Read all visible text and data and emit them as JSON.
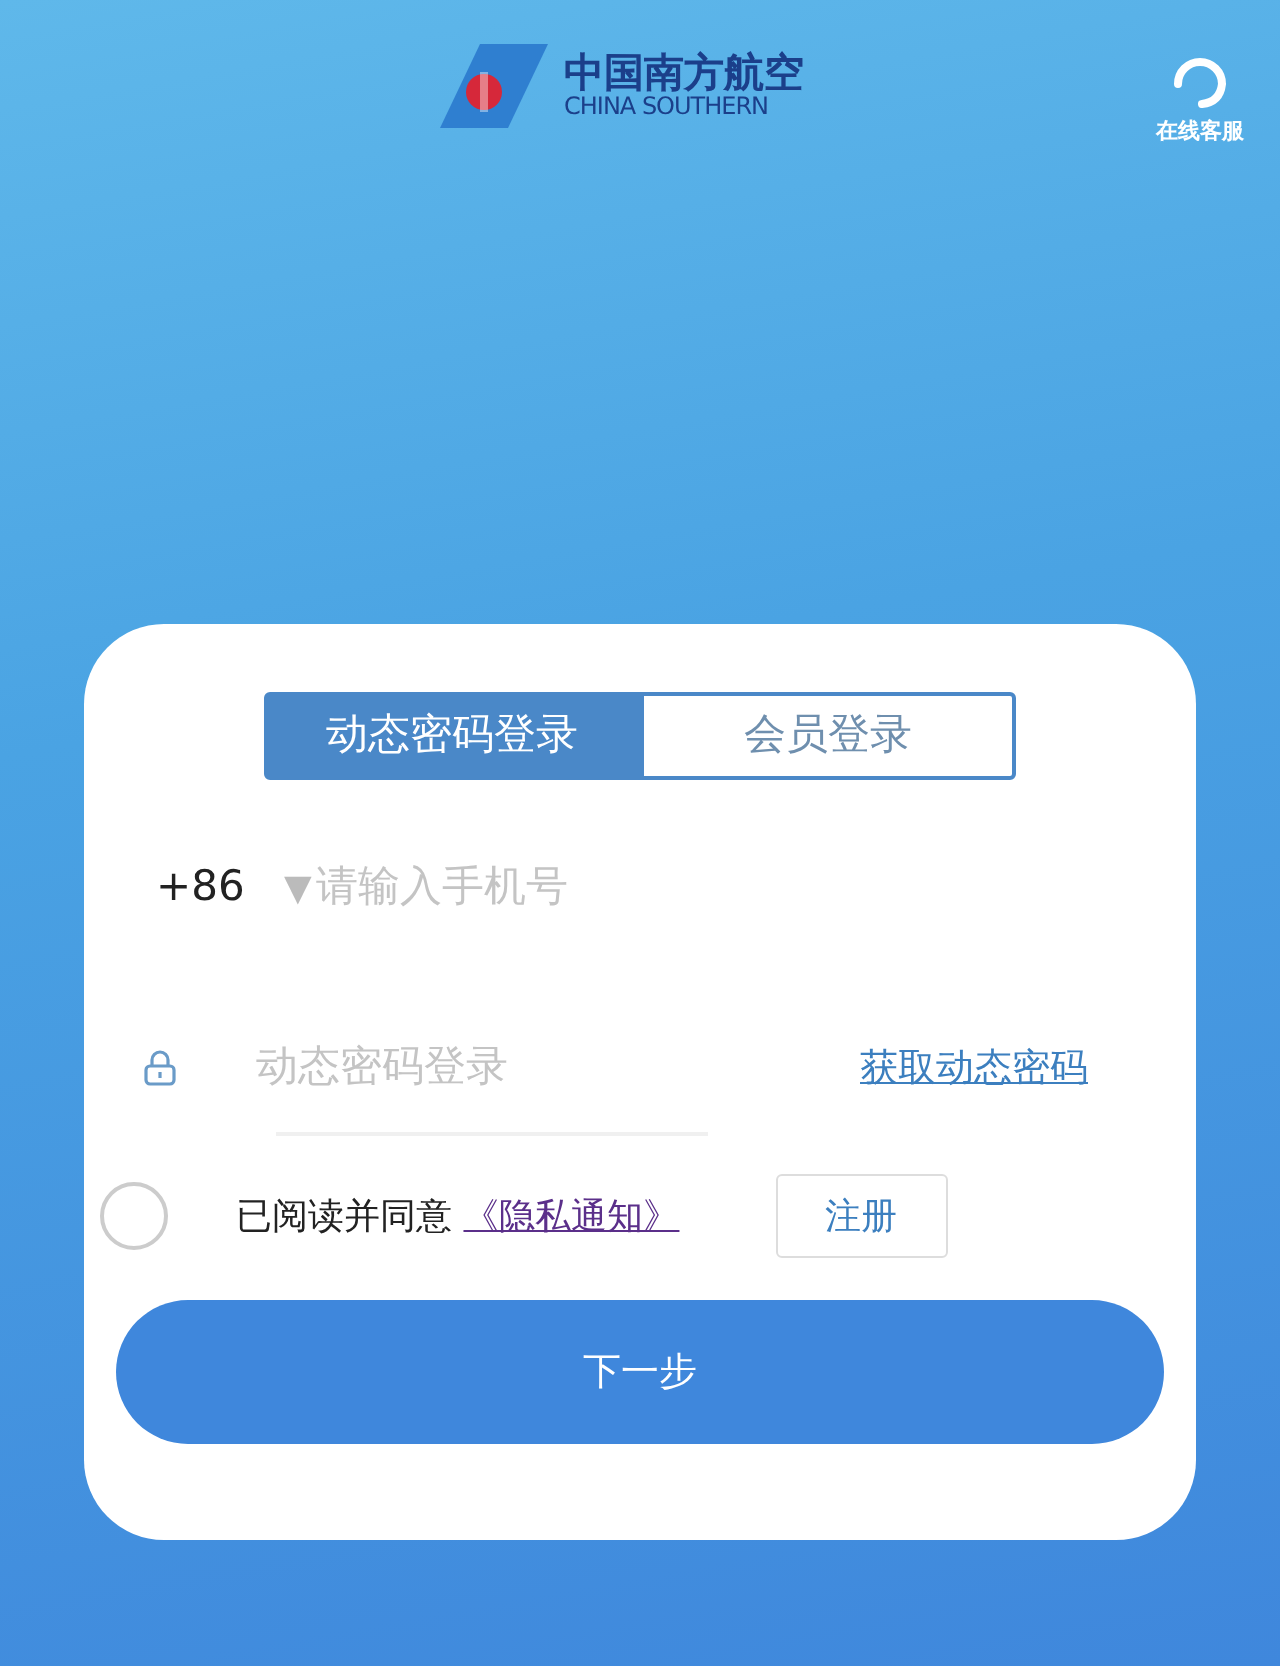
{
  "header": {
    "logo_title": "中国南方航空",
    "logo_subtitle": "CHINA SOUTHERN",
    "service_label": "在线客服"
  },
  "tabs": [
    {
      "label": "动态密码登录",
      "selected": true
    },
    {
      "label": "会员登录",
      "selected": false
    }
  ],
  "phone": {
    "country_code": "+86",
    "caret": "▼",
    "placeholder": "请输入手机号"
  },
  "password": {
    "placeholder": "动态密码登录",
    "get_code": "获取动态密码"
  },
  "agreement": {
    "checked": false,
    "text": "已阅读并同意",
    "link": "《隐私通知》"
  },
  "register_button": "注册",
  "next_button": "下一步"
}
